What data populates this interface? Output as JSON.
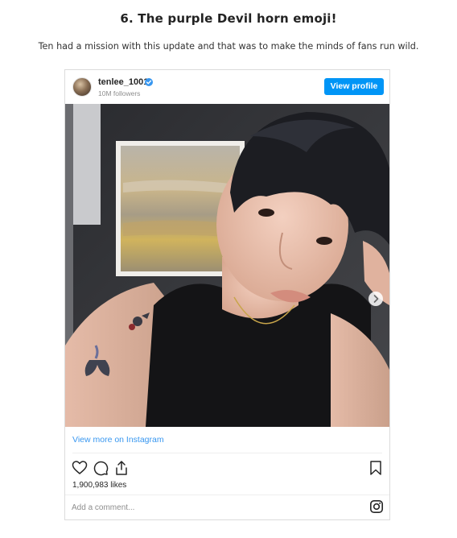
{
  "article": {
    "heading": "6. The purple Devil horn emoji!",
    "paragraph": "Ten had a mission with this update and that was to make the minds of fans run wild."
  },
  "post": {
    "username": "tenlee_1001",
    "followers": "10M followers",
    "view_profile_label": "View profile",
    "view_more_label": "View more on Instagram",
    "likes": "1,900,983 likes",
    "comment_placeholder": "Add a comment...",
    "carousel_total": 2,
    "carousel_active": 1
  },
  "icons": {
    "verified": "verified-badge-icon",
    "like": "heart-icon",
    "comment": "comment-icon",
    "share": "share-icon",
    "save": "bookmark-icon",
    "logo": "instagram-logo-icon",
    "next": "chevron-right-icon"
  },
  "colors": {
    "accent": "#0095f6",
    "link": "#3897f0",
    "text": "#262626",
    "muted": "#8e8e8e"
  }
}
